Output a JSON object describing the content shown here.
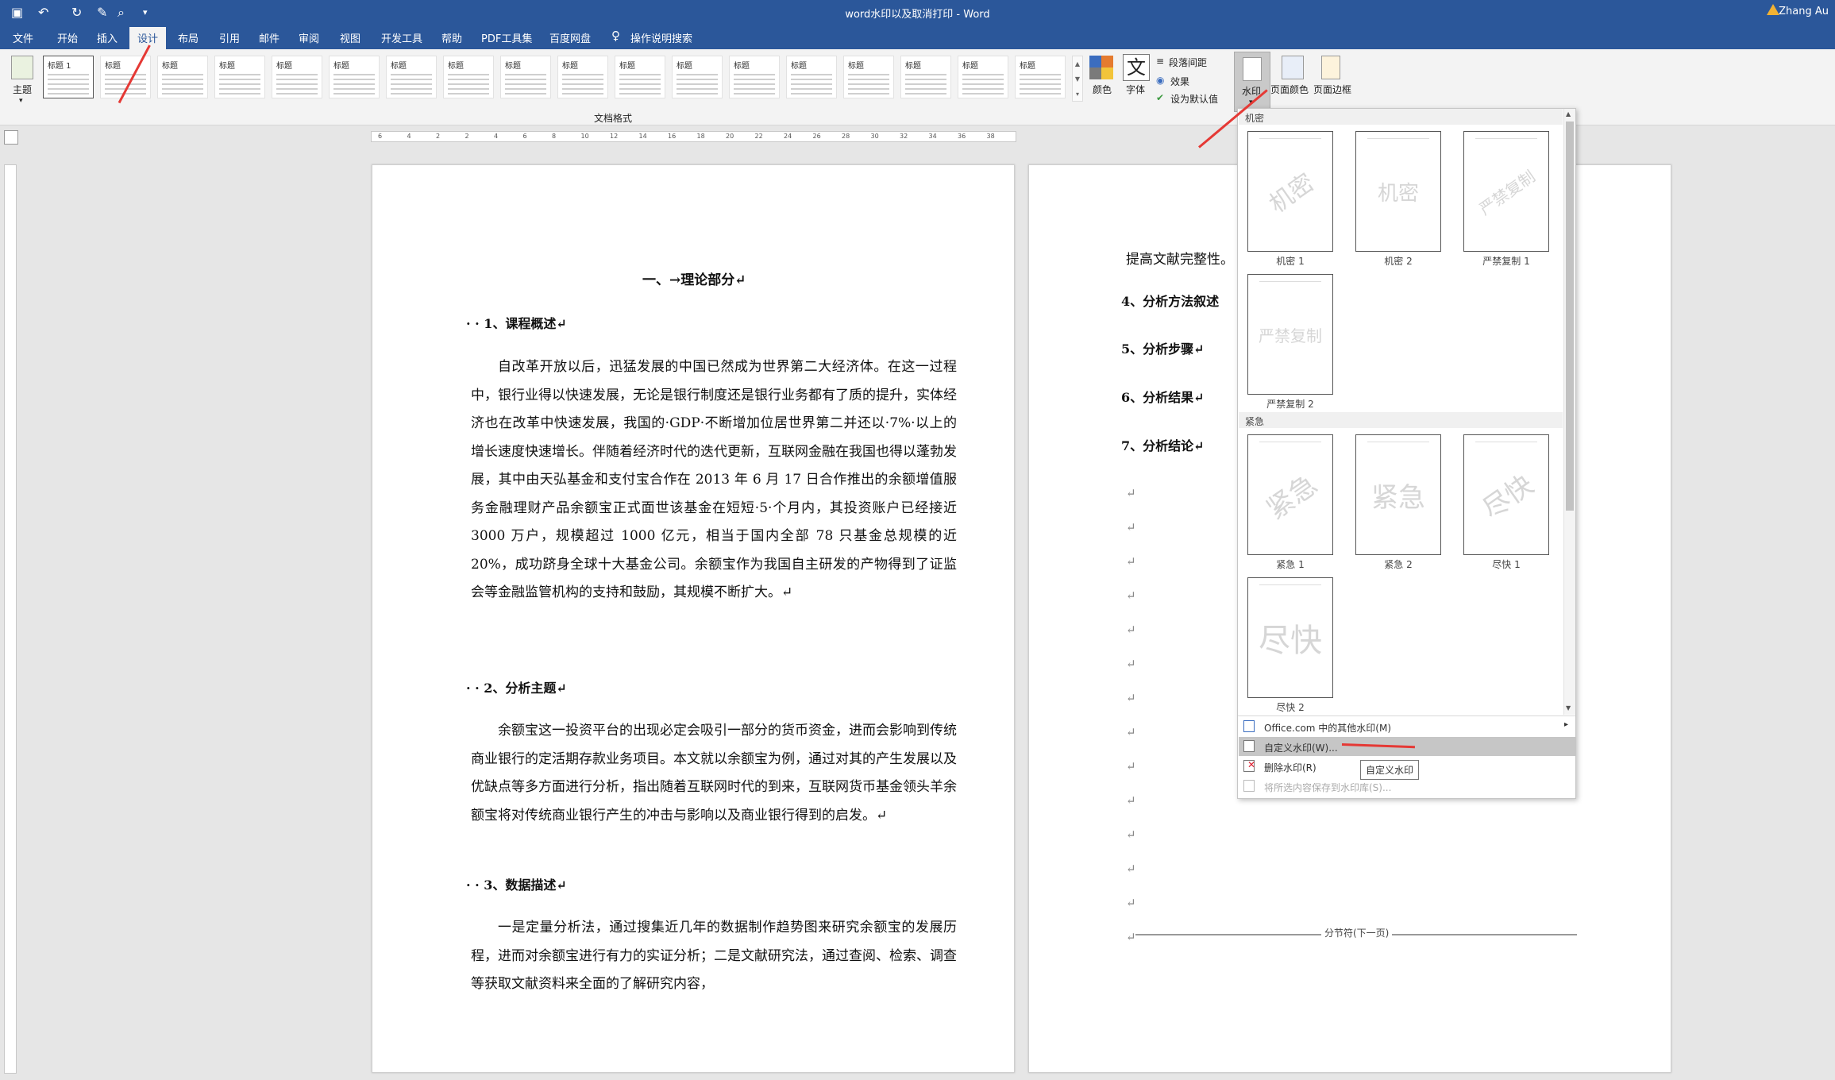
{
  "window": {
    "title": "word水印以及取消打印 - Word",
    "user": "Zhang Au"
  },
  "tabs": [
    "文件",
    "开始",
    "插入",
    "设计",
    "布局",
    "引用",
    "邮件",
    "审阅",
    "视图",
    "开发工具",
    "帮助",
    "PDF工具集",
    "百度网盘",
    "操作说明搜索"
  ],
  "ribbon": {
    "theme_label": "主题",
    "gallery_title_label": "标题",
    "gallery_heading_label": "标题 1",
    "group_label": "文档格式",
    "colors_label": "颜色",
    "fonts_label": "字体",
    "fonts_glyph": "文",
    "paragraph_spacing_label": "段落间距",
    "effects_label": "效果",
    "set_default_label": "设为默认值",
    "watermark_label": "水印",
    "page_color_label": "页面颜色",
    "page_border_label": "页面边框"
  },
  "ruler": {
    "top_ticks": [
      "6",
      "4",
      "2",
      "2",
      "4",
      "6",
      "8",
      "10",
      "12",
      "14",
      "16",
      "18",
      "20",
      "22",
      "24",
      "26",
      "28",
      "30",
      "32",
      "34",
      "36",
      "38"
    ]
  },
  "page1": {
    "h1": "一、→理论部分↵",
    "h_course": "· · 1、课程概述↵",
    "p_course": "自改革开放以后，迅猛发展的中国已然成为世界第二大经济体。在这一过程中，银行业得以快速发展，无论是银行制度还是银行业务都有了质的提升，实体经济也在改革中快速发展，我国的·GDP·不断增加位居世界第二并还以·7%·以上的增长速度快速增长。伴随着经济时代的迭代更新，互联网金融在我国也得以蓬勃发展，其中由天弘基金和支付宝合作在 2013 年 6 月 17 日合作推出的余额增值服务金融理财产品余额宝正式面世该基金在短短·5·个月内，其投资账户已经接近 3000 万户，规模超过 1000 亿元，相当于国内全部 78 只基金总规模的近 20%，成功跻身全球十大基金公司。余额宝作为我国自主研发的产物得到了证监会等金融监管机构的支持和鼓励，其规模不断扩大。↵",
    "h_topic": "· · 2、分析主题↵",
    "p_topic": "余额宝这一投资平台的出现必定会吸引一部分的货币资金，进而会影响到传统商业银行的定活期存款业务项目。本文就以余额宝为例，通过对其的产生发展以及优缺点等多方面进行分析，指出随着互联网时代的到来，互联网货币基金领头羊余额宝将对传统商业银行产生的冲击与影响以及商业银行得到的启发。↵",
    "h_data": "· · 3、数据描述↵",
    "p_data": "一是定量分析法，通过搜集近几年的数据制作趋势图来研究余额宝的发展历程，进而对余额宝进行有力的实证分析；二是文献研究法，通过查阅、检索、调查等获取文献资料来全面的了解研究内容，"
  },
  "page2": {
    "line1": "提高文献完整性。",
    "h4": "4、分析方法叙述",
    "h5": "5、分析步骤↵",
    "h6": "6、分析结果↵",
    "h7": "7、分析结论↵",
    "mark": "↵",
    "section_break": "分节符(下一页)"
  },
  "dropdown": {
    "section_confidential": "机密",
    "section_urgent": "紧急",
    "watermarks": [
      {
        "text": "机密",
        "caption": "机密 1"
      },
      {
        "text": "机密",
        "caption": "机密 2"
      },
      {
        "text": "严禁复制",
        "caption": "严禁复制 1"
      },
      {
        "text": "严禁复制",
        "caption": "严禁复制 2"
      },
      {
        "text": "紧急",
        "caption": "紧急 1"
      },
      {
        "text": "紧急",
        "caption": "紧急 2"
      },
      {
        "text": "尽快",
        "caption": "尽快 1"
      },
      {
        "text": "尽快",
        "caption": "尽快 2"
      }
    ],
    "menu": {
      "more": "Office.com 中的其他水印(M)",
      "custom": "自定义水印(W)...",
      "remove": "删除水印(R)",
      "save": "将所选内容保存到水印库(S)..."
    },
    "tooltip": "自定义水印"
  }
}
